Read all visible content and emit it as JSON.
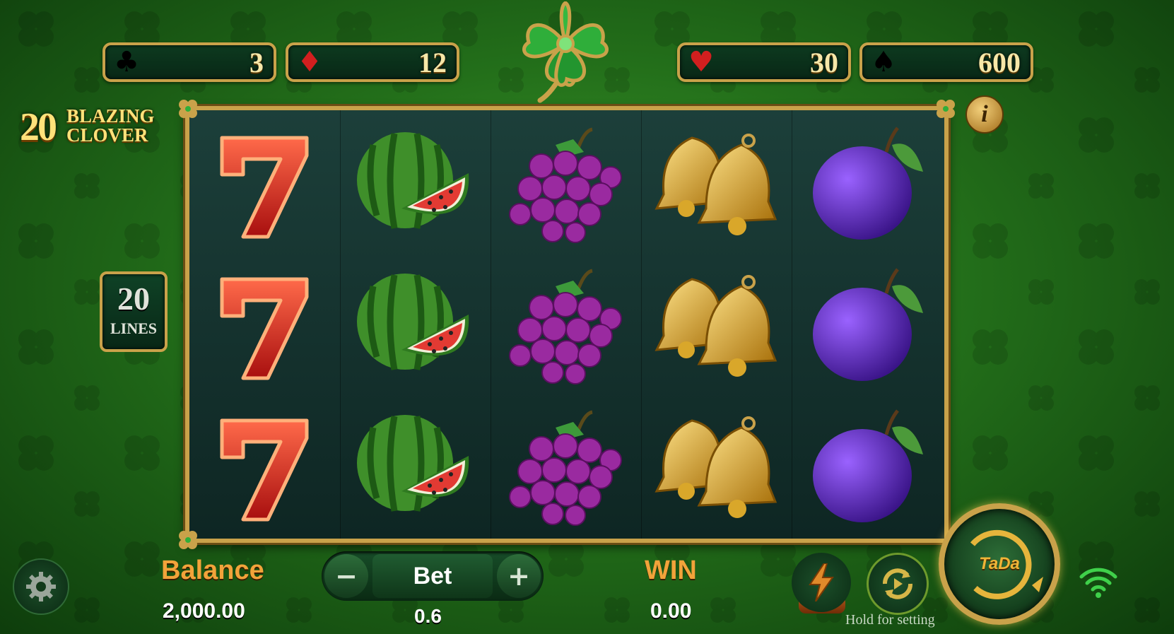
{
  "suits": [
    {
      "icon": "club-icon",
      "glyph": "♣",
      "value": "3",
      "color": "#000000"
    },
    {
      "icon": "diamond-icon",
      "glyph": "♦",
      "value": "12",
      "color": "#d21f1f"
    },
    {
      "icon": "heart-icon",
      "glyph": "♥",
      "value": "30",
      "color": "#d21f1f"
    },
    {
      "icon": "spade-icon",
      "glyph": "♠",
      "value": "600",
      "color": "#000000"
    }
  ],
  "logo": {
    "number": "20",
    "line1": "BLAZING",
    "line2": "CLOVER"
  },
  "lines": {
    "number": "20",
    "label": "LINES"
  },
  "reels": [
    [
      "seven",
      "seven",
      "seven"
    ],
    [
      "watermelon",
      "watermelon",
      "watermelon"
    ],
    [
      "grapes",
      "grapes",
      "grapes"
    ],
    [
      "bells",
      "bells",
      "bells"
    ],
    [
      "plum",
      "plum",
      "plum"
    ]
  ],
  "info_label": "i",
  "balance": {
    "label": "Balance",
    "value": "2,000.00"
  },
  "bet": {
    "label": "Bet",
    "value": "0.6",
    "minus": "−",
    "plus": "+"
  },
  "win": {
    "label": "WIN",
    "value": "0.00"
  },
  "hold_text": "Hold for setting",
  "spin_label": "TaDa",
  "colors": {
    "gold": "#c9a24a",
    "label_orange": "#f2a33a",
    "green_dark": "#0b2b14"
  }
}
